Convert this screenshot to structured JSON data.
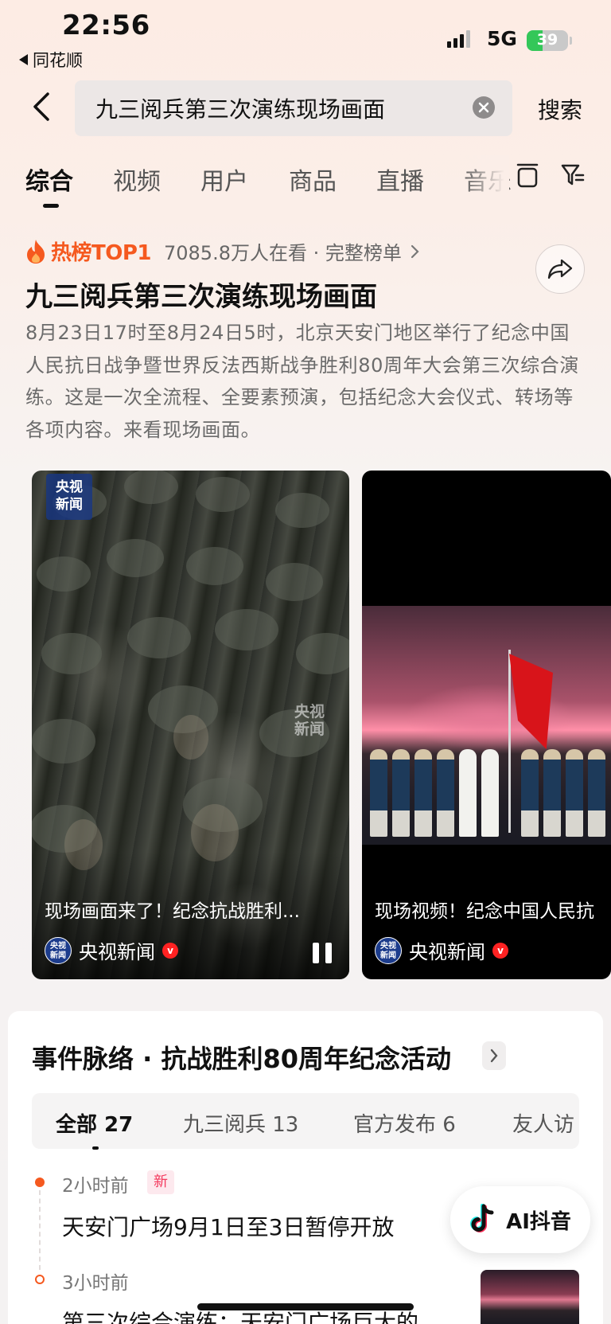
{
  "status_bar": {
    "time": "22:56",
    "back_app": "同花顺",
    "network": "5G",
    "battery": "39",
    "battery_level": 0.39
  },
  "search": {
    "query": "九三阅兵第三次演练现场画面",
    "submit_label": "搜索"
  },
  "tabs": [
    {
      "label": "综合",
      "active": true
    },
    {
      "label": "视频",
      "active": false
    },
    {
      "label": "用户",
      "active": false
    },
    {
      "label": "商品",
      "active": false
    },
    {
      "label": "直播",
      "active": false
    },
    {
      "label": "音乐",
      "active": false
    }
  ],
  "hot": {
    "rank_label": "热榜TOP1",
    "views_text": "7085.8万人在看 · 完整榜单",
    "title": "九三阅兵第三次演练现场画面",
    "description": "8月23日17时至8月24日5时，北京天安门地区举行了纪念中国人民抗日战争暨世界反法西斯战争胜利80周年大会第三次综合演练。这是一次全流程、全要素预演，包括纪念大会仪式、转场等各项内容。来看现场画面。"
  },
  "videos": [
    {
      "title": "现场画面来了！纪念抗战胜利...",
      "author": "央视新闻",
      "logo_text": "央视\n新闻",
      "watermark": "央视\n新闻"
    },
    {
      "title": "现场视频！纪念中国人民抗",
      "author": "央视新闻"
    }
  ],
  "timeline": {
    "title": "事件脉络 · 抗战胜利80周年纪念活动",
    "filters": [
      {
        "label": "全部 27",
        "active": true
      },
      {
        "label": "九三阅兵 13",
        "active": false
      },
      {
        "label": "官方发布 6",
        "active": false
      },
      {
        "label": "友人访",
        "active": false
      }
    ],
    "items": [
      {
        "time": "2小时前",
        "badge": "新",
        "text": "天安门广场9月1日至3日暂停开放"
      },
      {
        "time": "3小时前",
        "text": "第三次综合演练：天安门广场巨大的"
      }
    ]
  },
  "ai_button": {
    "label": "AI抖音"
  },
  "colors": {
    "accent": "#f5591f",
    "new_badge": "#f43a5e",
    "verified": "#ff2222",
    "battery": "#34c759"
  }
}
